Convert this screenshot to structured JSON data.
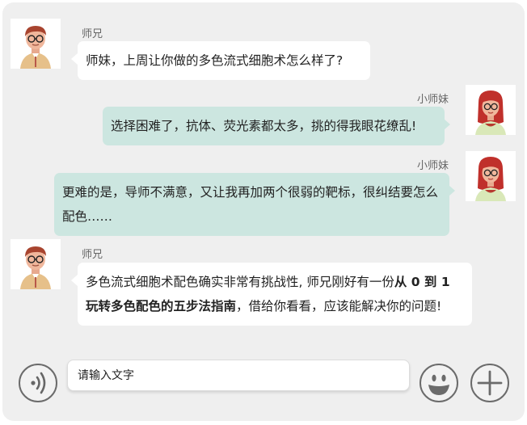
{
  "messages": [
    {
      "sender": "师兄",
      "side": "left",
      "parts": [
        {
          "text": "师妹，上周让你做的多色流式细胞术怎么样了?",
          "bold": false
        }
      ]
    },
    {
      "sender": "小师妹",
      "side": "right",
      "parts": [
        {
          "text": "选择困难了，抗体、荧光素都太多，挑的得我眼花缭乱!",
          "bold": false
        }
      ]
    },
    {
      "sender": "小师妹",
      "side": "right",
      "parts": [
        {
          "text": "更难的是，导师不满意，又让我再加两个很弱的靶标，很纠结要怎么配色……",
          "bold": false
        }
      ]
    },
    {
      "sender": "师兄",
      "side": "left",
      "parts": [
        {
          "text": "多色流式细胞术配色确实非常有挑战性, 师兄刚好有一份",
          "bold": false
        },
        {
          "text": "从 0 到 1 玩转多色配色的五步法指南",
          "bold": true
        },
        {
          "text": "，借给你看看，应该能解决你的问题!",
          "bold": false
        }
      ]
    }
  ],
  "composer": {
    "placeholder": "请输入文字",
    "voice_icon": "voice-icon",
    "emoji_icon": "smiley-icon",
    "plus_icon": "plus-icon"
  },
  "colors": {
    "background": "#efefef",
    "left_bubble": "#ffffff",
    "right_bubble": "#cce6e0"
  }
}
